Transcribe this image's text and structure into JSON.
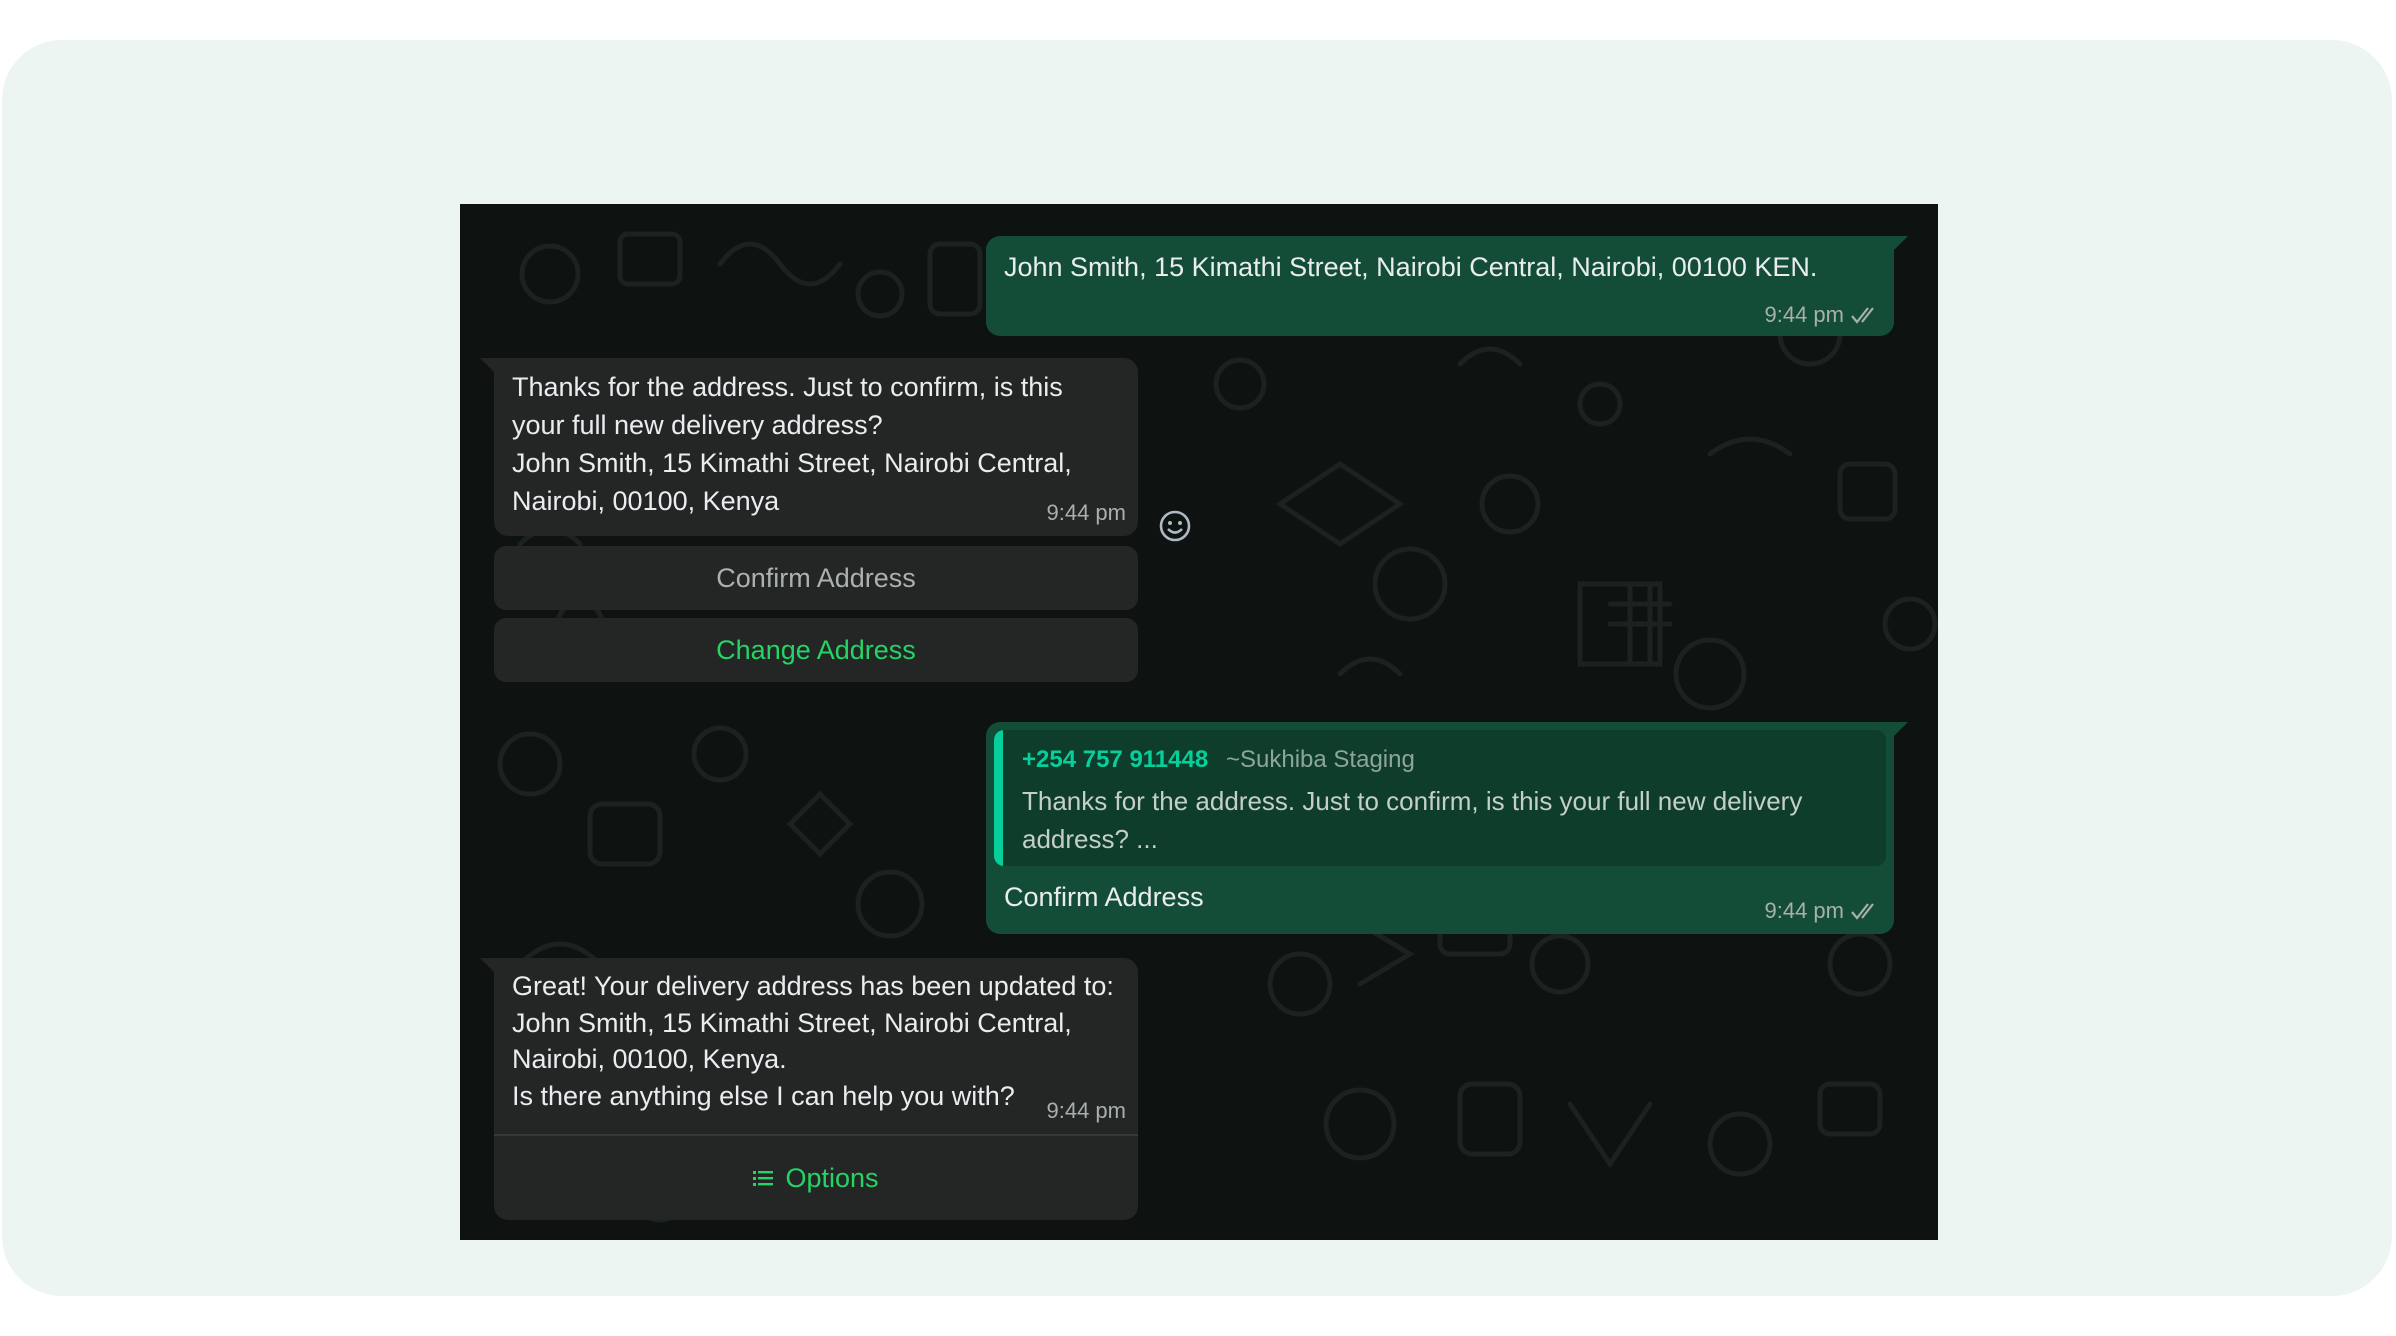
{
  "messages": {
    "m1": {
      "text": "John Smith, 15 Kimathi Street, Nairobi Central, Nairobi, 00100 KEN.",
      "time": "9:44 pm"
    },
    "m2": {
      "text": "Thanks for the address. Just to confirm, is this\nyour full new delivery address?\nJohn Smith, 15 Kimathi Street, Nairobi Central,\nNairobi, 00100, Kenya",
      "time": "9:44 pm",
      "buttons": [
        "Confirm Address",
        "Change Address"
      ]
    },
    "m3": {
      "quote_phone": "+254 757 911448",
      "quote_name": "~Sukhiba Staging",
      "quote_text": "Thanks for the address. Just to confirm, is this your full new delivery address? ...",
      "text": "Confirm Address",
      "time": "9:44 pm"
    },
    "m4": {
      "text": "Great! Your delivery address has been updated to:\nJohn Smith, 15 Kimathi Street, Nairobi Central,\nNairobi, 00100, Kenya.\nIs there anything else I can help you with?",
      "time": "9:44 pm",
      "options_label": "Options"
    }
  },
  "colors": {
    "outgoing_bubble": "#144d37",
    "incoming_bubble": "#232625",
    "accent_green": "#25d366",
    "chat_background": "#0e1211"
  },
  "icons": [
    "double-check-icon",
    "emoji-reaction-icon",
    "list-icon"
  ]
}
